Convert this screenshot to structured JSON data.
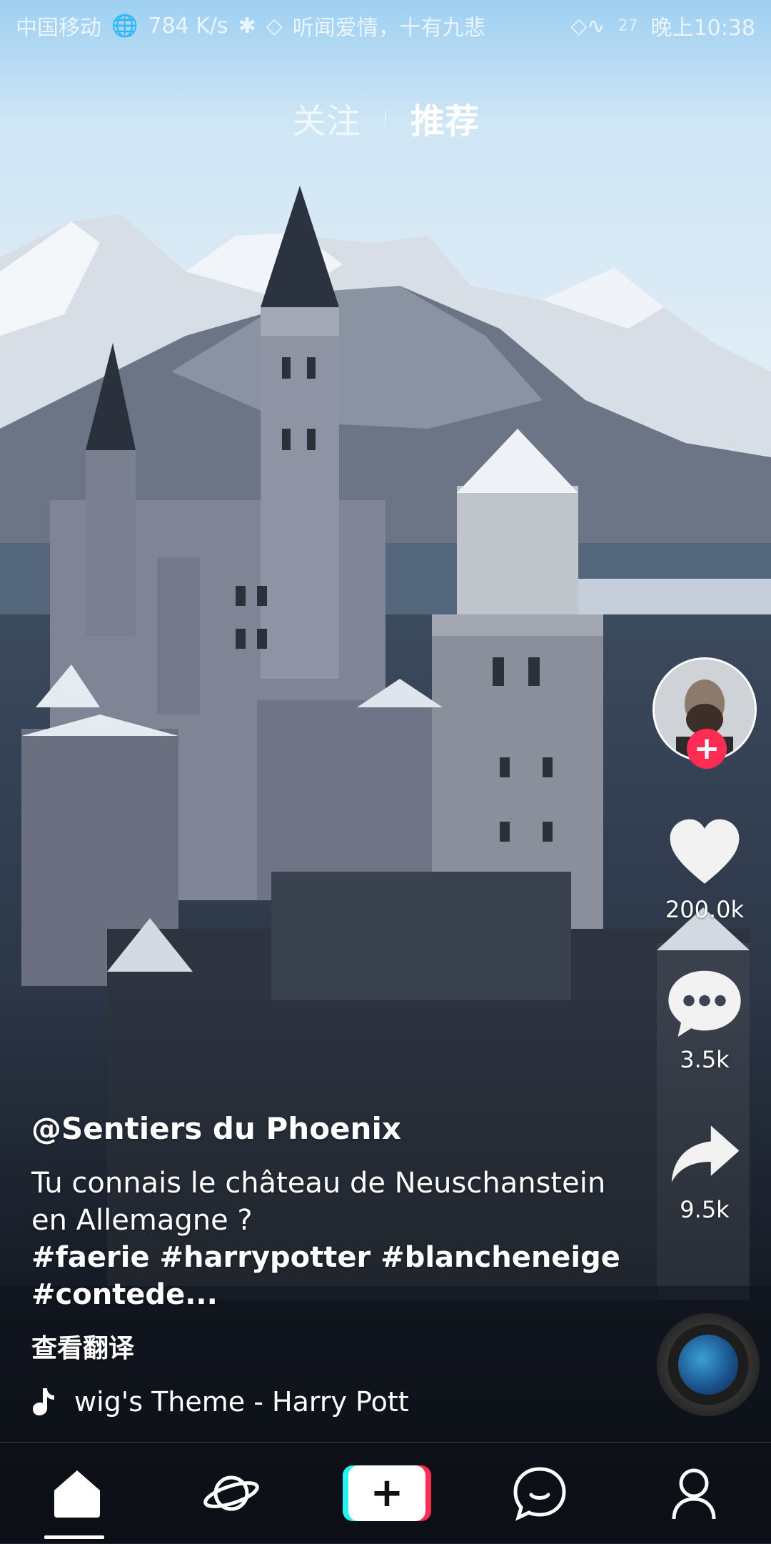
{
  "status_bar": {
    "carrier": "中国移动",
    "speed": "784 K/s",
    "song": "听闻爱情，十有九悲",
    "battery": "27",
    "time": "晚上10:38"
  },
  "top_tabs": [
    {
      "label": "关注",
      "active": false
    },
    {
      "label": "推荐",
      "active": true
    }
  ],
  "rail": {
    "likes": "200.0k",
    "comments": "3.5k",
    "shares": "9.5k"
  },
  "video": {
    "username": "@Sentiers du Phoenix",
    "description": "Tu connais le château de Neuschanstein en Allemagne ?",
    "hashtags": "#faerie #harrypotter #blancheneige #contede...",
    "translate": "查看翻译",
    "music": "wig's Theme - Harry Pott"
  },
  "colors": {
    "accent": "#fe2c55",
    "cyan": "#26f3ef"
  },
  "nav": [
    {
      "icon": "home-icon",
      "active": true
    },
    {
      "icon": "discover-icon",
      "active": false
    },
    {
      "icon": "create-icon",
      "active": false
    },
    {
      "icon": "inbox-icon",
      "active": false
    },
    {
      "icon": "profile-icon",
      "active": false
    }
  ]
}
